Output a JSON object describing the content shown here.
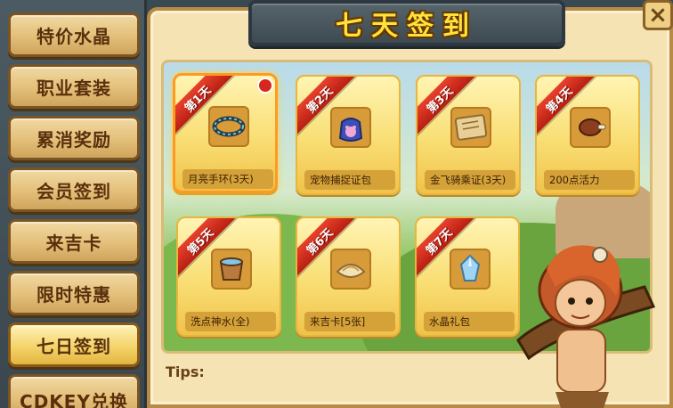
{
  "title": "七天签到",
  "sidebar": {
    "items": [
      {
        "label": "特价水晶",
        "active": false
      },
      {
        "label": "职业套装",
        "active": false
      },
      {
        "label": "累消奖励",
        "active": false
      },
      {
        "label": "会员签到",
        "active": false
      },
      {
        "label": "来吉卡",
        "active": false
      },
      {
        "label": "限时特惠",
        "active": false
      },
      {
        "label": "七日签到",
        "active": true
      },
      {
        "label": "CDKEY兑换",
        "active": false
      }
    ]
  },
  "days": [
    {
      "day_label": "第1天",
      "reward": "月亮手环(3天)",
      "icon": "bracelet-icon",
      "selected": true,
      "has_notice": true
    },
    {
      "day_label": "第2天",
      "reward": "宠物捕捉证包",
      "icon": "pet-bag-icon",
      "selected": false,
      "has_notice": false
    },
    {
      "day_label": "第3天",
      "reward": "金飞骑乘证(3天)",
      "icon": "mount-certificate-icon",
      "selected": false,
      "has_notice": false
    },
    {
      "day_label": "第4天",
      "reward": "200点活力",
      "icon": "meat-icon",
      "selected": false,
      "has_notice": false
    },
    {
      "day_label": "第5天",
      "reward": "洗点神水(全)",
      "icon": "water-bucket-icon",
      "selected": false,
      "has_notice": false
    },
    {
      "day_label": "第6天",
      "reward": "来吉卡[5张]",
      "icon": "card-pack-icon",
      "selected": false,
      "has_notice": false
    },
    {
      "day_label": "第7天",
      "reward": "水晶礼包",
      "icon": "crystal-icon",
      "selected": false,
      "has_notice": false
    }
  ],
  "tips_label": "Tips:",
  "close_label": "×",
  "colors": {
    "ribbon": "#d4301f",
    "title_text": "#ffe23a",
    "card_gold": "#f9de74"
  }
}
